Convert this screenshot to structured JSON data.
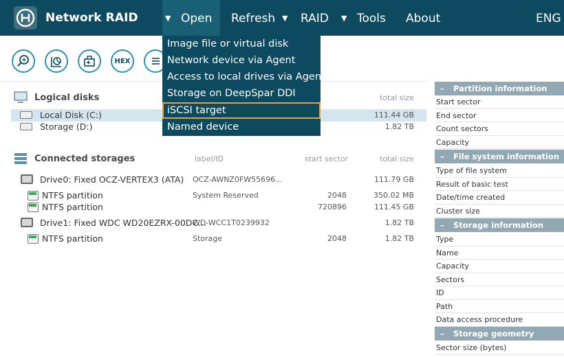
{
  "app": {
    "title": "Network RAID"
  },
  "menu": {
    "open": "Open",
    "refresh": "Refresh",
    "raid": "RAID",
    "tools": "Tools",
    "about": "About",
    "lang": "ENG",
    "caret": "▼"
  },
  "open_menu": {
    "items": [
      "Image file or virtual disk",
      "Network device via Agent",
      "Access to local drives via Agent",
      "Storage on DeepSpar DDI",
      "iSCSI target",
      "Named device"
    ],
    "highlighted_index": 4
  },
  "toolbar": {
    "buttons": [
      "search-icon",
      "pie-chart-icon",
      "file-export-icon",
      "hex-icon",
      "list-icon"
    ],
    "hex_label": "HEX"
  },
  "logical_disks": {
    "title": "Logical disks",
    "col_total_size": "total size",
    "items": [
      {
        "name": "Local Disk (C:)",
        "size": "111.44 GB",
        "selected": true
      },
      {
        "name": "Storage (D:)",
        "size": "1.82 TB",
        "selected": false
      }
    ]
  },
  "connected_storages": {
    "title": "Connected storages",
    "col_label": "label/ID",
    "col_start": "start sector",
    "col_total": "total size",
    "drives": [
      {
        "name": "Drive0: Fixed OCZ-VERTEX3 (ATA)",
        "label": "OCZ-AWNZ0FW55696...",
        "size": "111.79 GB",
        "partitions": [
          {
            "name": "NTFS partition",
            "label": "System Reserved",
            "start": "2048",
            "size": "350.02 MB"
          },
          {
            "name": "NTFS partition",
            "label": "",
            "start": "720896",
            "size": "111.45 GB"
          }
        ]
      },
      {
        "name": "Drive1: Fixed WDC WD20EZRX-00DC...",
        "label": "WD-WCC1T0239932",
        "size": "1.82 TB",
        "partitions": [
          {
            "name": "NTFS partition",
            "label": "Storage",
            "start": "2048",
            "size": "1.82 TB"
          }
        ]
      }
    ]
  },
  "info_panel": {
    "sections": [
      {
        "title": "Partition information",
        "rows": [
          "Start sector",
          "End sector",
          "Count sectors",
          "Capacity"
        ]
      },
      {
        "title": "File system information",
        "rows": [
          "Type of file system",
          "Result of basic test",
          "Date/time created",
          "Cluster size"
        ]
      },
      {
        "title": "Storage information",
        "rows": [
          "Type",
          "Name",
          "Capacity",
          "Sectors",
          "ID",
          "Path",
          "Data access procedure"
        ]
      },
      {
        "title": "Storage geometry",
        "rows": [
          "Sector size (bytes)"
        ]
      }
    ],
    "dash": "–"
  },
  "colors": {
    "topbar": "#0d4a5f",
    "accent": "#2a8fb4",
    "highlight_border": "#f0a030",
    "panel_header": "#92a9b4"
  }
}
